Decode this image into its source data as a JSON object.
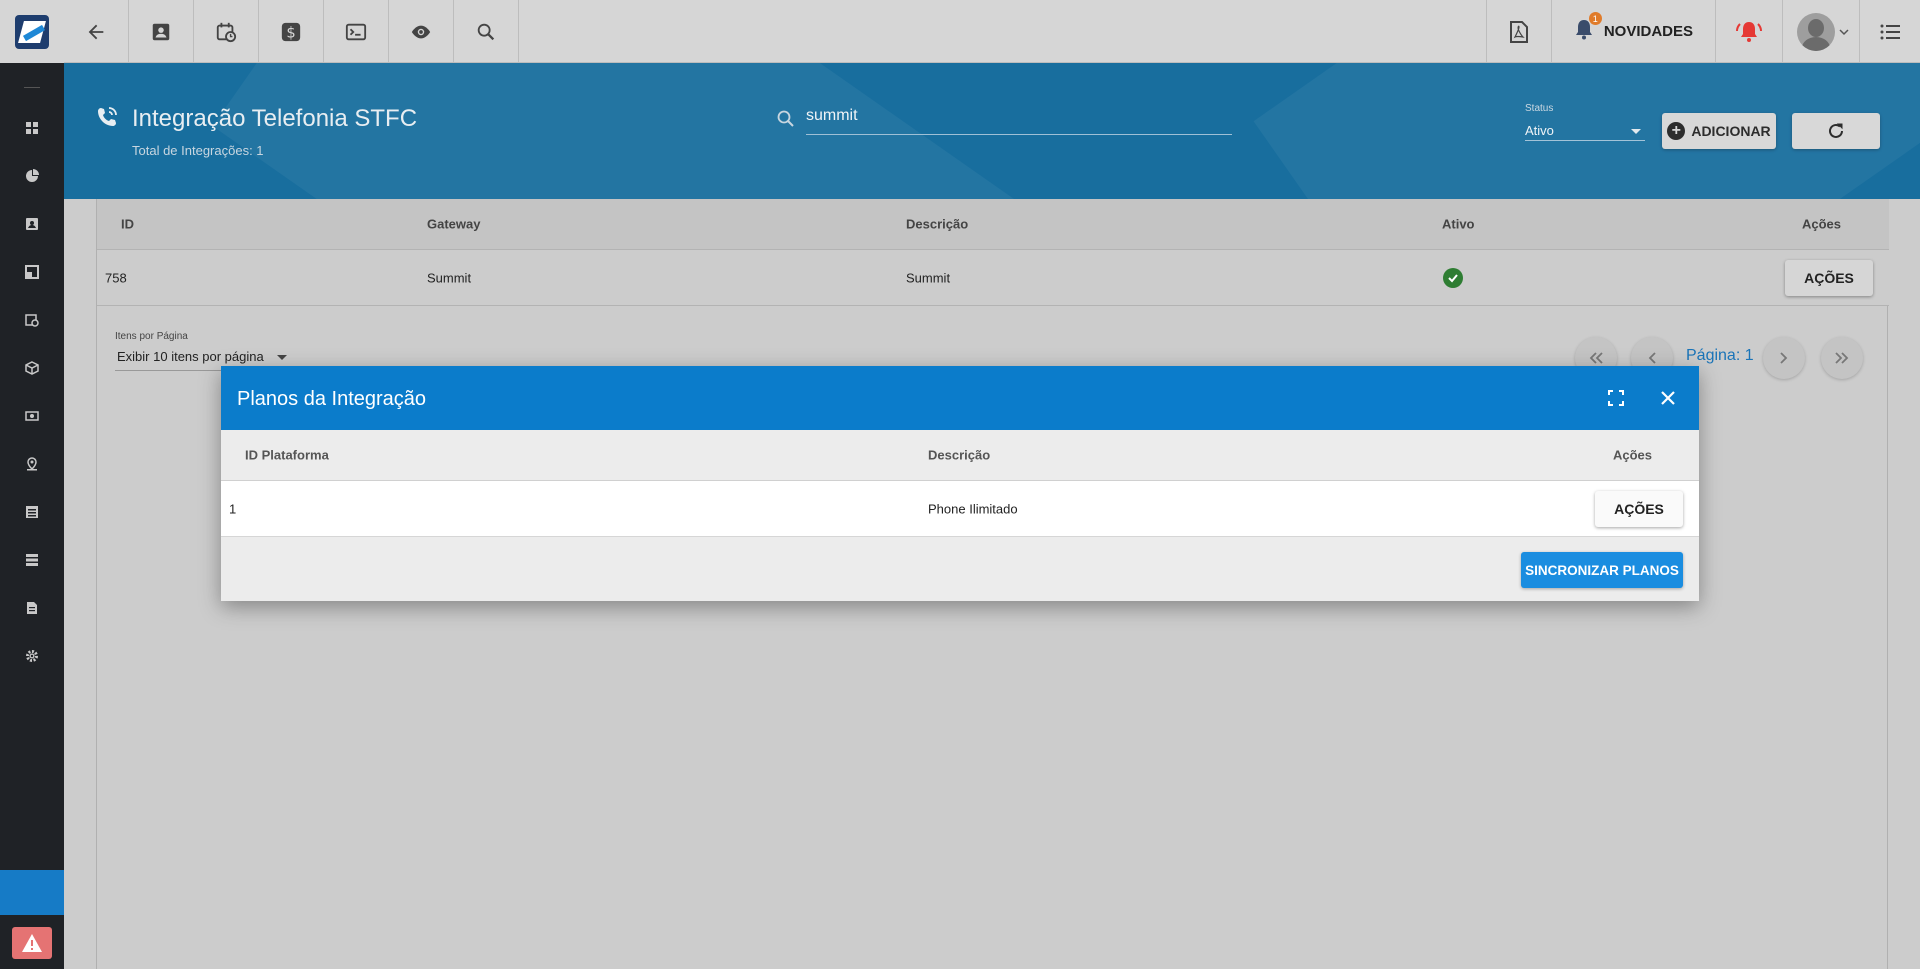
{
  "topbar": {
    "novidades_label": "NOVIDADES",
    "notification_count": "1",
    "icons": [
      "back-arrow-icon",
      "contact-card-icon",
      "calendar-clock-icon",
      "dollar-icon",
      "terminal-icon",
      "eye-icon",
      "search-icon",
      "pdf-icon",
      "bell-icon",
      "alarm-bell-icon",
      "avatar",
      "list-menu-icon"
    ]
  },
  "header": {
    "title": "Integração Telefonia STFC",
    "subtitle": "Total de Integrações: 1",
    "search_value": "summit",
    "status_label": "Status",
    "status_value": "Ativo",
    "add_label": "ADICIONAR"
  },
  "grid": {
    "columns": [
      "ID",
      "Gateway",
      "Descrição",
      "Ativo",
      "Ações"
    ],
    "rows": [
      {
        "id": "758",
        "gateway": "Summit",
        "descricao": "Summit",
        "ativo": true,
        "acoes_label": "AÇÕES"
      }
    ]
  },
  "pagination": {
    "items_per_page_label": "Itens por Página",
    "items_per_page_value": "Exibir 10 itens por página",
    "page_label": "Página: 1"
  },
  "modal": {
    "title": "Planos da Integração",
    "columns": [
      "ID Plataforma",
      "Descrição",
      "Ações"
    ],
    "rows": [
      {
        "id_plataforma": "1",
        "descricao": "Phone Ilimitado",
        "acoes_label": "AÇÕES"
      }
    ],
    "sync_label": "SINCRONIZAR PLANOS"
  },
  "colors": {
    "header_blue": "#186e9e",
    "modal_blue": "#0b7ccb",
    "sidebar_dark": "#1f2226",
    "accent_blue": "#1a8de0",
    "success_green": "#2e7d32",
    "alert_red": "#e53935"
  }
}
